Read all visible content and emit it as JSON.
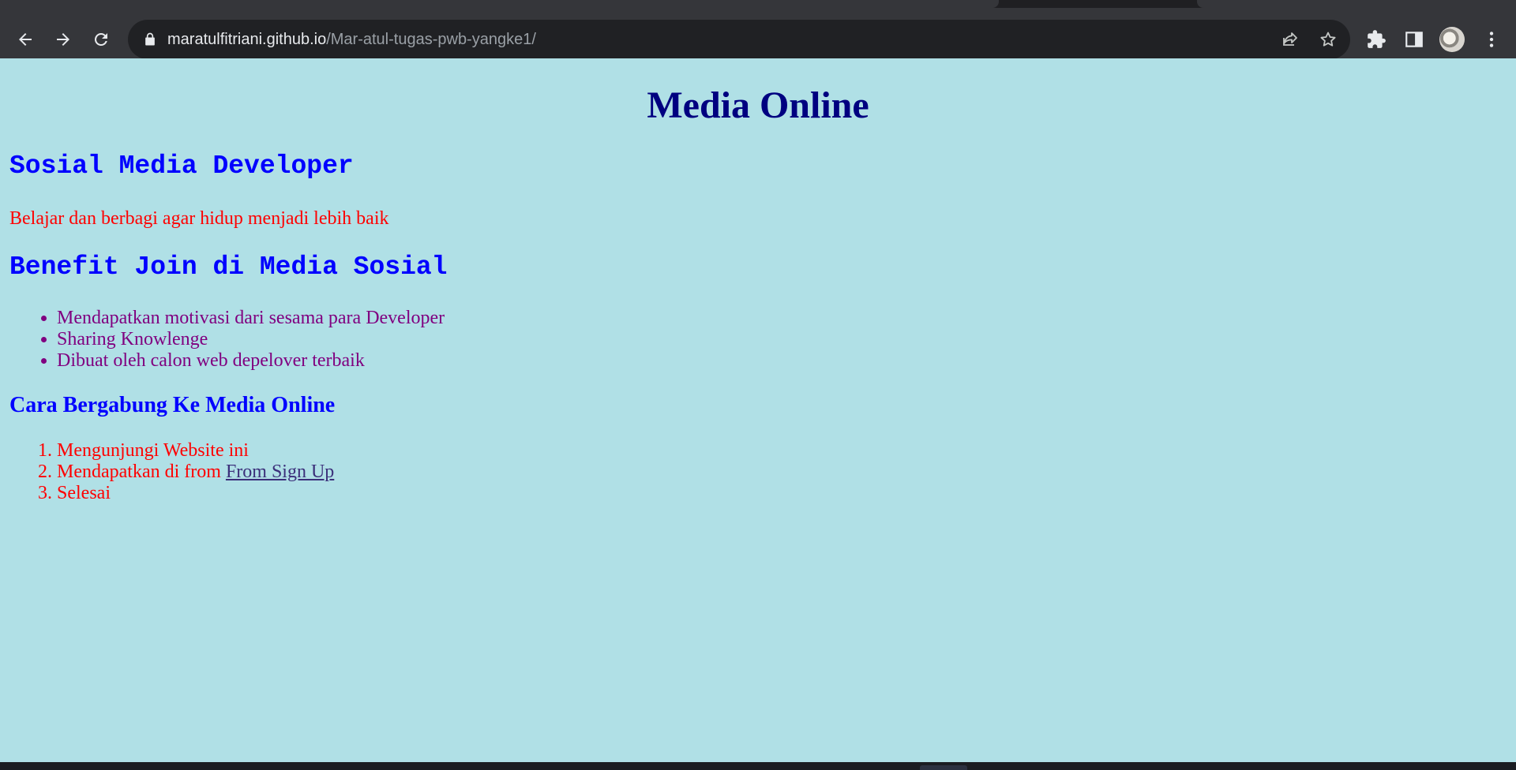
{
  "browser": {
    "url_host": "maratulfitriani.github.io",
    "url_path": "/Mar-atul-tugas-pwb-yangke1/",
    "icons": {
      "back": "back-arrow-icon",
      "forward": "forward-arrow-icon",
      "reload": "reload-icon",
      "lock": "lock-icon",
      "share": "share-icon",
      "bookmark": "star-icon",
      "extensions": "puzzle-icon",
      "side_panel": "side-panel-icon",
      "menu": "more-vert-icon"
    }
  },
  "page": {
    "title": "Media Online",
    "section1_heading": "Sosial Media Developer",
    "tagline": "Belajar dan berbagi agar hidup menjadi lebih baik",
    "section2_heading": "Benefit Join di Media Sosial",
    "benefits": [
      "Mendapatkan motivasi dari sesama para Developer",
      "Sharing Knowlenge",
      "Dibuat oleh calon web depelover terbaik"
    ],
    "join_heading": "Cara Bergabung Ke Media Online",
    "steps": {
      "step1": "Mengunjungi Website ini",
      "step2_prefix": "Mendapatkan di from ",
      "step2_link": "From Sign Up",
      "step3": "Selesai"
    },
    "colors": {
      "background": "#b0e0e6",
      "title": "#000080",
      "heading": "#0000ff",
      "tagline": "#ff0000",
      "benefits": "#800080",
      "steps": "#ff0000"
    }
  }
}
